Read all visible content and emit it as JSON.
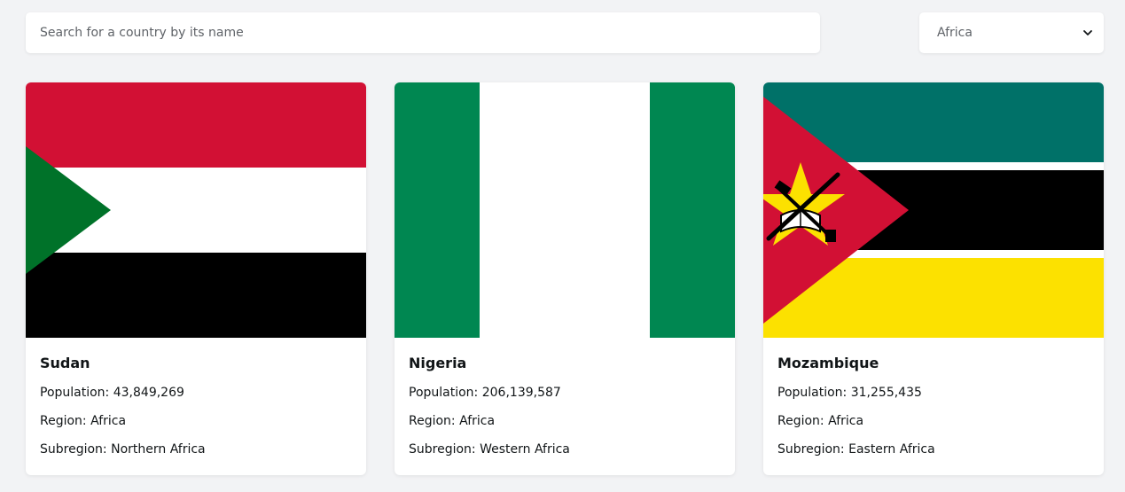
{
  "search": {
    "placeholder": "Search for a country by its name",
    "value": ""
  },
  "region_filter": {
    "selected": "Africa",
    "icon": "chevron-down-icon"
  },
  "labels": {
    "population": "Population:",
    "region": "Region:",
    "subregion": "Subregion:"
  },
  "countries": [
    {
      "name": "Sudan",
      "population": "43,849,269",
      "region": "Africa",
      "subregion": "Northern Africa",
      "flag_colors": {
        "top": "#d21034",
        "middle": "#ffffff",
        "bottom": "#000000",
        "triangle": "#007229"
      }
    },
    {
      "name": "Nigeria",
      "population": "206,139,587",
      "region": "Africa",
      "subregion": "Western Africa",
      "flag_colors": {
        "green": "#008751",
        "white": "#ffffff"
      }
    },
    {
      "name": "Mozambique",
      "population": "31,255,435",
      "region": "Africa",
      "subregion": "Eastern Africa",
      "flag_colors": {
        "top": "#007168",
        "middle": "#000000",
        "bottom": "#fce100",
        "fimbriation": "#ffffff",
        "triangle": "#d21034",
        "star": "#fce100"
      }
    }
  ]
}
